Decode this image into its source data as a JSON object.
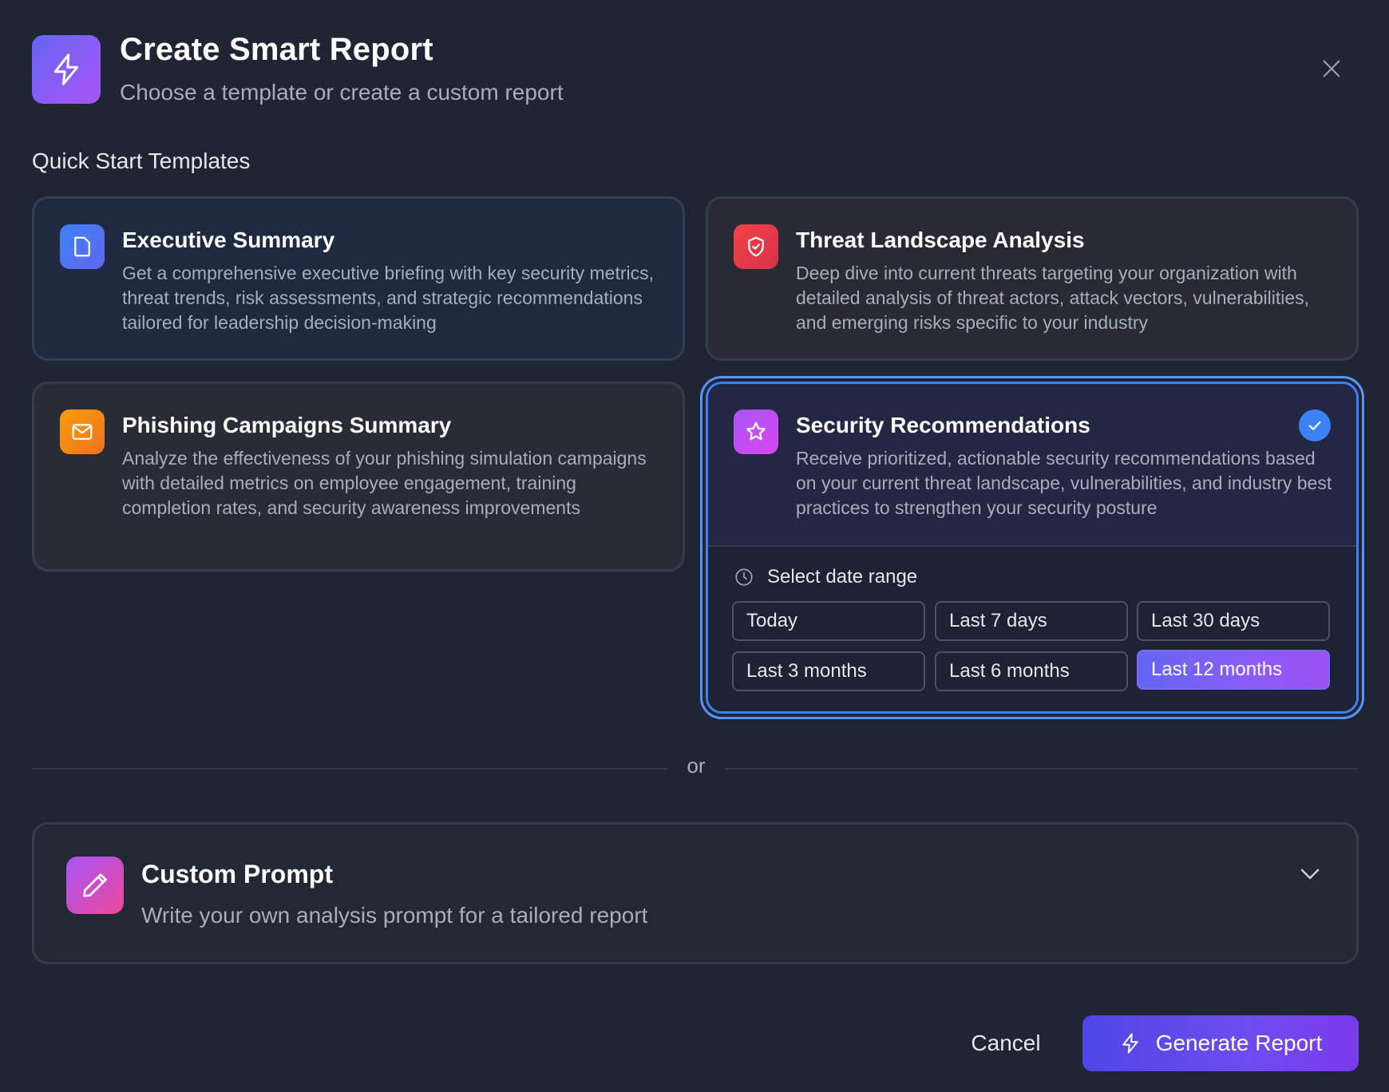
{
  "header": {
    "title": "Create Smart Report",
    "subtitle": "Choose a template or create a custom report",
    "icon": "lightning-icon",
    "close_icon": "close-icon"
  },
  "section_label": "Quick Start Templates",
  "templates": [
    {
      "title": "Executive Summary",
      "description": "Get a comprehensive executive briefing with key security metrics, threat trends, risk assessments, and strategic recommendations tailored for leadership decision-making",
      "icon": "document-icon",
      "color": "#3b82f6"
    },
    {
      "title": "Threat Landscape Analysis",
      "description": "Deep dive into current threats targeting your organization with detailed analysis of threat actors, attack vectors, vulnerabilities, and emerging risks specific to your industry",
      "icon": "shield-icon",
      "color": "#ef4444"
    },
    {
      "title": "Phishing Campaigns Summary",
      "description": "Analyze the effectiveness of your phishing simulation campaigns with detailed metrics on employee engagement, training completion rates, and security awareness improvements",
      "icon": "mail-icon",
      "color": "#f59e0b"
    },
    {
      "title": "Security Recommendations",
      "description": "Receive prioritized, actionable security recommendations based on your current threat landscape, vulnerabilities, and industry best practices to strengthen your security posture",
      "icon": "star-icon",
      "color": "#a855f7",
      "selected": true
    }
  ],
  "date_range": {
    "label": "Select date range",
    "icon": "clock-icon",
    "options": [
      "Today",
      "Last 7 days",
      "Last 30 days",
      "Last 3 months",
      "Last 6 months",
      "Last 12 months"
    ],
    "selected": "Last 12 months"
  },
  "divider_text": "or",
  "custom_prompt": {
    "title": "Custom Prompt",
    "description": "Write your own analysis prompt for a tailored report",
    "icon": "pencil-icon",
    "toggle_icon": "chevron-down-icon"
  },
  "footer": {
    "cancel_label": "Cancel",
    "generate_label": "Generate Report",
    "generate_icon": "lightning-icon"
  },
  "colors": {
    "background": "#1f2533",
    "accent_blue": "#3b82f6",
    "accent_purple": "#8b5cf6"
  }
}
